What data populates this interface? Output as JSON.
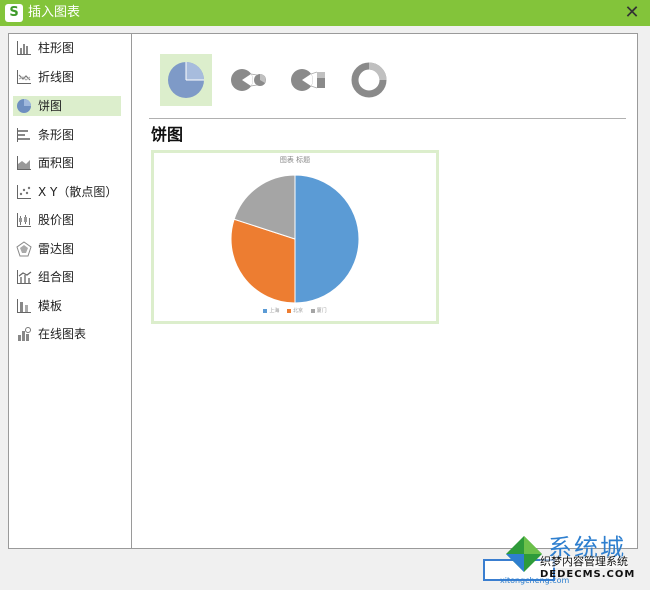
{
  "window": {
    "title": "插入图表"
  },
  "sidebar": {
    "items": [
      {
        "label": "柱形图",
        "icon": "column-chart-icon"
      },
      {
        "label": "折线图",
        "icon": "line-chart-icon"
      },
      {
        "label": "饼图",
        "icon": "pie-chart-icon"
      },
      {
        "label": "条形图",
        "icon": "bar-chart-icon"
      },
      {
        "label": "面积图",
        "icon": "area-chart-icon"
      },
      {
        "label": "X Y（散点图）",
        "icon": "scatter-chart-icon"
      },
      {
        "label": "股价图",
        "icon": "stock-chart-icon"
      },
      {
        "label": "雷达图",
        "icon": "radar-chart-icon"
      },
      {
        "label": "组合图",
        "icon": "combo-chart-icon"
      },
      {
        "label": "模板",
        "icon": "template-icon"
      },
      {
        "label": "在线图表",
        "icon": "online-chart-icon"
      }
    ],
    "selected_index": 2
  },
  "subtypes": [
    {
      "icon": "pie-icon",
      "selected": true
    },
    {
      "icon": "pie-of-pie-icon",
      "selected": false
    },
    {
      "icon": "bar-of-pie-icon",
      "selected": false
    },
    {
      "icon": "doughnut-icon",
      "selected": false
    }
  ],
  "preview": {
    "title": "饼图",
    "chart_data": {
      "type": "pie",
      "title": "图表 标题",
      "categories": [
        "上海",
        "北京",
        "厦门"
      ],
      "values": [
        50,
        30,
        20
      ],
      "colors": [
        "#5b9bd5",
        "#ed7d31",
        "#a5a5a5"
      ],
      "legend": "bottom"
    }
  },
  "watermark": {
    "brand": "系统城",
    "subtitle": "织梦内容管理系统",
    "url": "DEDECMS.COM",
    "site": "xitongcheng.com"
  },
  "colors": {
    "titlebar": "#83c43a",
    "selection": "#dceecc",
    "accent": "#3a7ed0"
  }
}
